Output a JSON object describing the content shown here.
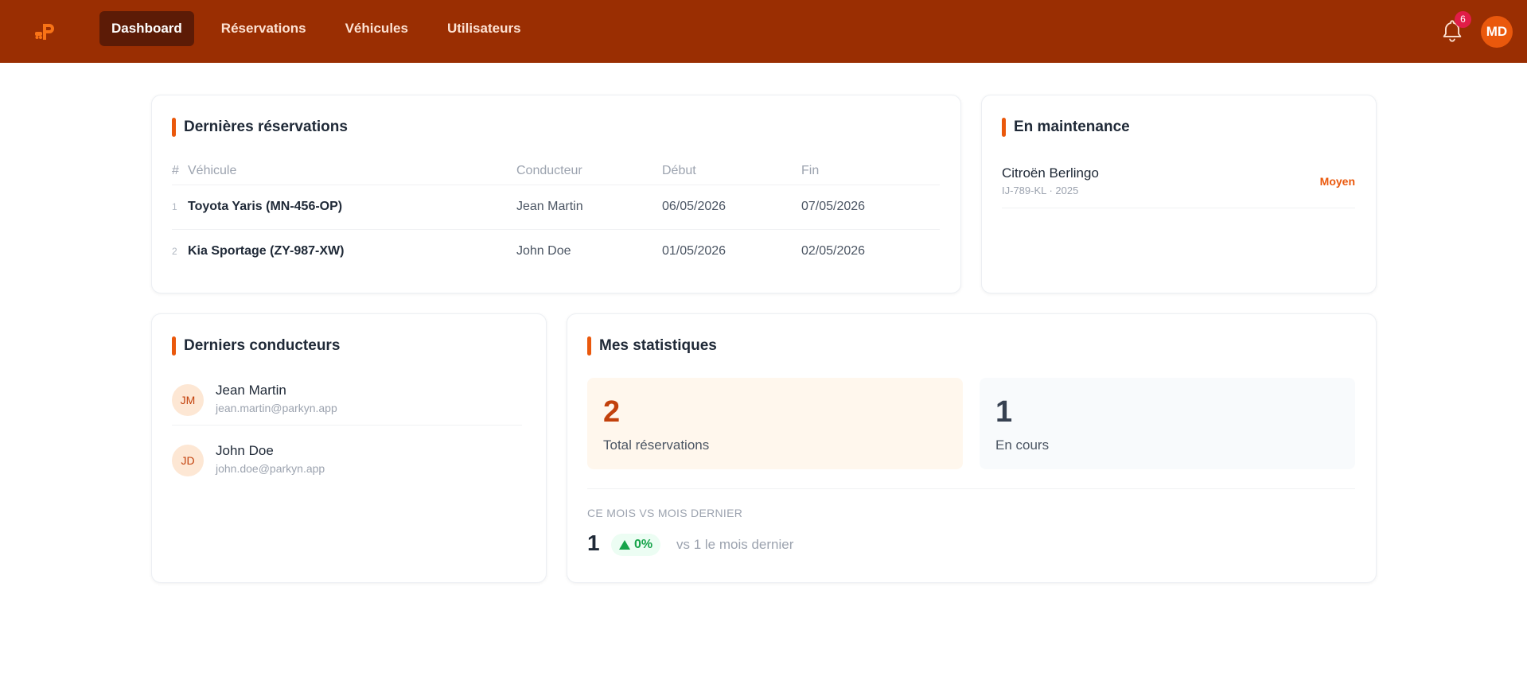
{
  "nav": {
    "items": [
      {
        "label": "Dashboard",
        "active": true
      },
      {
        "label": "Réservations",
        "active": false
      },
      {
        "label": "Véhicules",
        "active": false
      },
      {
        "label": "Utilisateurs",
        "active": false
      }
    ],
    "notifications_count": "6",
    "user_initials": "MD"
  },
  "reservations": {
    "title": "Dernières réservations",
    "headers": {
      "index": "#",
      "vehicle": "Véhicule",
      "driver": "Conducteur",
      "start": "Début",
      "end": "Fin"
    },
    "rows": [
      {
        "index": "1",
        "vehicle": "Toyota Yaris (MN-456-OP)",
        "driver": "Jean Martin",
        "start": "06/05/2026",
        "end": "07/05/2026"
      },
      {
        "index": "2",
        "vehicle": "Kia Sportage (ZY-987-XW)",
        "driver": "John Doe",
        "start": "01/05/2026",
        "end": "02/05/2026"
      }
    ]
  },
  "maintenance": {
    "title": "En maintenance",
    "items": [
      {
        "name": "Citroën Berlingo",
        "sub": "IJ-789-KL · 2025",
        "level": "Moyen"
      }
    ]
  },
  "drivers": {
    "title": "Derniers conducteurs",
    "items": [
      {
        "initials": "JM",
        "name": "Jean Martin",
        "email": "jean.martin@parkyn.app"
      },
      {
        "initials": "JD",
        "name": "John Doe",
        "email": "john.doe@parkyn.app"
      }
    ]
  },
  "stats": {
    "title": "Mes statistiques",
    "total_value": "2",
    "total_label": "Total réservations",
    "current_value": "1",
    "current_label": "En cours",
    "comparison_title": "CE MOIS VS MOIS DERNIER",
    "comparison_value": "1",
    "comparison_change": "0%",
    "comparison_text": "vs 1 le mois dernier"
  },
  "colors": {
    "navbar": "#9a2e02",
    "accent": "#ea580c",
    "positive": "#16a34a"
  }
}
